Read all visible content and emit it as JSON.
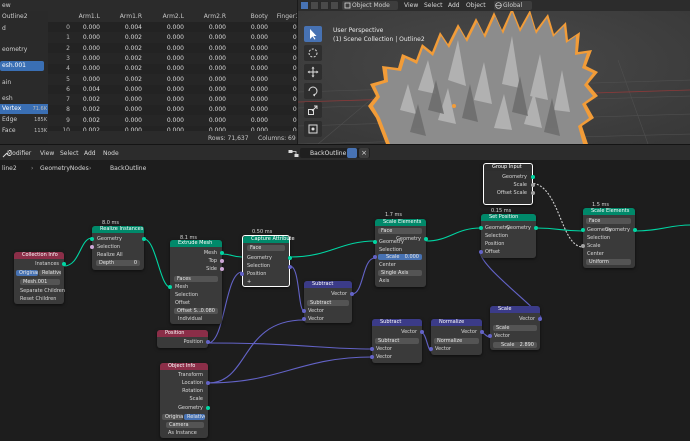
{
  "sheet": {
    "top_label": "ew",
    "tree": {
      "path_item": "Outline2",
      "items": [
        "d",
        "eometry",
        "esh.001",
        "ain",
        "esh",
        "Vertex",
        "Edge",
        "Face"
      ],
      "vertex_count": "71.6K",
      "edge_count": "185K",
      "face_count": "113K"
    },
    "columns": [
      "Arm1.L",
      "Arm1.R",
      "Arm2.L",
      "Arm2.R",
      "Booty",
      "Finger1.1.L",
      "Fin"
    ],
    "rows": [
      {
        "i": "0",
        "v": [
          "0.000",
          "0.004",
          "0.000",
          "0.000",
          "0.000",
          "0.000",
          "0"
        ]
      },
      {
        "i": "1",
        "v": [
          "0.000",
          "0.002",
          "0.000",
          "0.000",
          "0.000",
          "0.000",
          "0"
        ]
      },
      {
        "i": "2",
        "v": [
          "0.000",
          "0.002",
          "0.000",
          "0.000",
          "0.000",
          "0.000",
          "0"
        ]
      },
      {
        "i": "3",
        "v": [
          "0.000",
          "0.002",
          "0.000",
          "0.000",
          "0.000",
          "0.000",
          "0"
        ]
      },
      {
        "i": "4",
        "v": [
          "0.000",
          "0.002",
          "0.000",
          "0.000",
          "0.000",
          "0.000",
          "0"
        ]
      },
      {
        "i": "5",
        "v": [
          "0.000",
          "0.002",
          "0.000",
          "0.000",
          "0.000",
          "0.000",
          "0"
        ]
      },
      {
        "i": "6",
        "v": [
          "0.004",
          "0.000",
          "0.000",
          "0.000",
          "0.000",
          "0.000",
          "0"
        ]
      },
      {
        "i": "7",
        "v": [
          "0.002",
          "0.000",
          "0.000",
          "0.000",
          "0.000",
          "0.000",
          "0"
        ]
      },
      {
        "i": "8",
        "v": [
          "0.002",
          "0.000",
          "0.000",
          "0.000",
          "0.000",
          "0.000",
          "0"
        ]
      },
      {
        "i": "9",
        "v": [
          "0.002",
          "0.000",
          "0.000",
          "0.000",
          "0.000",
          "0.000",
          "0"
        ]
      },
      {
        "i": "10",
        "v": [
          "0.002",
          "0.000",
          "0.000",
          "0.000",
          "0.000",
          "0.000",
          "0"
        ]
      }
    ],
    "footer_rows": "Rows: 71,637",
    "footer_cols": "Columns: 69"
  },
  "viewport": {
    "mode": "Object Mode",
    "menus": [
      "View",
      "Select",
      "Add",
      "Object"
    ],
    "orientation": "Global",
    "title": "User Perspective",
    "subtitle": "(1) Scene Collection | Outline2"
  },
  "node_header": {
    "menus": [
      "Modifier",
      "View",
      "Select",
      "Add",
      "Node"
    ],
    "tree_name": "BackOutline",
    "breadcrumbs": [
      "line2",
      "GeometryNodes",
      "BackOutline"
    ]
  },
  "nodes": {
    "collection_info": {
      "title": "Collection Info",
      "out": "Instances",
      "opt1": "Original",
      "opt2": "Relative",
      "collection": "Mesh.001",
      "sep": "Separate Children",
      "reset": "Reset Children"
    },
    "realize": {
      "timing": "8.0 ms",
      "title": "Realize Instances",
      "s1": "Geometry",
      "s2": "Selection",
      "s3": "Realize All",
      "s4": "Depth",
      "s4v": "0"
    },
    "extrude": {
      "timing": "8.1 ms",
      "title": "Extrude Mesh",
      "o1": "Mesh",
      "o2": "Top",
      "o3": "Side",
      "mode": "Faces",
      "i1": "Mesh",
      "i2": "Selection",
      "i3": "Offset",
      "offset_scale": "Offset S...",
      "offset_val": "0.080",
      "i5": "Individual"
    },
    "capture": {
      "timing": "0.50 ms",
      "title": "Capture Attribute",
      "domain": "Face",
      "i1": "Geometry",
      "i2": "Selection",
      "i3": "Position",
      "plus": "+"
    },
    "subtract1": {
      "title": "Subtract",
      "out": "Vector",
      "op": "Subtract",
      "i1": "Vector",
      "i2": "Vector"
    },
    "scale1": {
      "timing": "1.7 ms",
      "title": "Scale Elements",
      "domain": "Face",
      "o1": "Geometry",
      "i1": "Geometry",
      "i2": "Selection",
      "scale_label": "Scale",
      "scale_val": "0.000",
      "i4": "Center",
      "axis": "Single Axis",
      "i5": "Axis"
    },
    "group_input": {
      "title": "Group Input",
      "o1": "Geometry",
      "o2": "Scale",
      "o3": "Offset Scale"
    },
    "set_position": {
      "timing": "0.15 ms",
      "title": "Set Position",
      "o1": "Geometry",
      "i1": "Geometry",
      "i2": "Selection",
      "i3": "Position",
      "i4": "Offset"
    },
    "scale2": {
      "timing": "1.5 ms",
      "title": "Scale Elements",
      "domain": "Face",
      "o1": "Geometry",
      "i1": "Geometry",
      "i2": "Selection",
      "i3": "Scale",
      "i4": "Center",
      "mode": "Uniform"
    },
    "position": {
      "title": "Position",
      "out": "Position"
    },
    "subtract2": {
      "title": "Subtract",
      "out": "Vector",
      "op": "Subtract",
      "i1": "Vector",
      "i2": "Vector"
    },
    "normalize": {
      "title": "Normalize",
      "out": "Vector",
      "op": "Normalize",
      "i1": "Vector"
    },
    "scale_vec": {
      "title": "Scale",
      "out": "Vector",
      "op": "Scale",
      "i1": "Vector",
      "scale_label": "Scale",
      "scale_val": "2.890"
    },
    "object_info": {
      "title": "Object Info",
      "o1": "Transform",
      "o2": "Location",
      "o3": "Rotation",
      "o4": "Scale",
      "o5": "Geometry",
      "opt1": "Original",
      "opt2": "Relative",
      "object": "Camera",
      "as_instance": "As Instance"
    }
  },
  "colors": {
    "geometry": "#00d6a3",
    "vector": "#6363c7",
    "float": "#a1a1a1",
    "object": "#ed9e5c",
    "selection_outline": "#f29c38",
    "accent": "#4772b3"
  }
}
